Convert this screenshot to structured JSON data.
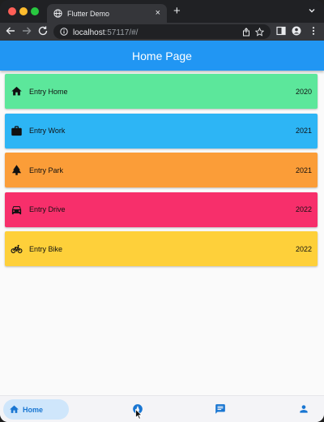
{
  "browser": {
    "tab_title": "Flutter Demo",
    "tab_close": "×",
    "new_tab": "+",
    "url_host": "localhost",
    "url_rest": ":57117/#/"
  },
  "app": {
    "title": "Home Page",
    "entries": [
      {
        "label": "Entry Home",
        "year": "2020",
        "icon": "home-icon",
        "color": "#5ce79b"
      },
      {
        "label": "Entry Work",
        "year": "2021",
        "icon": "briefcase-icon",
        "color": "#2db5f5"
      },
      {
        "label": "Entry Park",
        "year": "2021",
        "icon": "tree-icon",
        "color": "#fb9d38"
      },
      {
        "label": "Entry Drive",
        "year": "2022",
        "icon": "car-icon",
        "color": "#f72f6b"
      },
      {
        "label": "Entry Bike",
        "year": "2022",
        "icon": "bike-icon",
        "color": "#fed03a"
      }
    ],
    "bottom_nav": {
      "home_label": "Home",
      "items": [
        "home-icon",
        "explore-icon",
        "chat-icon",
        "person-icon"
      ]
    },
    "colors": {
      "appbar": "#2196f3",
      "accent": "#1976d2",
      "pill": "#cfe6fb"
    }
  }
}
